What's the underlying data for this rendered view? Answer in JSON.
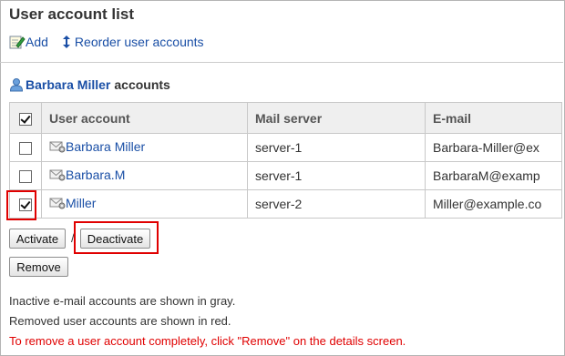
{
  "page": {
    "title": "User account list"
  },
  "toolbar": {
    "add_label": "Add",
    "reorder_label": "Reorder user accounts"
  },
  "section": {
    "user_name": "Barbara Miller",
    "suffix": "accounts"
  },
  "table": {
    "columns": [
      "User account",
      "Mail server",
      "E-mail"
    ],
    "rows": [
      {
        "checked": false,
        "account": "Barbara Miller",
        "server": "server-1",
        "email": "Barbara-Miller@ex"
      },
      {
        "checked": false,
        "account": "Barbara.M",
        "server": "server-1",
        "email": "BarbaraM@examp"
      },
      {
        "checked": true,
        "account": "Miller",
        "server": "server-2",
        "email": "Miller@example.co"
      }
    ]
  },
  "buttons": {
    "activate": "Activate",
    "separator": "/",
    "deactivate": "Deactivate",
    "remove": "Remove"
  },
  "notes": {
    "line1": "Inactive e-mail accounts are shown in gray.",
    "line2": "Removed user accounts are shown in red.",
    "line3": "To remove a user account completely, click \"Remove\" on the details screen."
  },
  "colors": {
    "link": "#1a4fa6",
    "highlight": "#e00000",
    "header_bg": "#efefef"
  },
  "icons": {
    "add": "pencil-note-icon",
    "reorder": "up-down-arrow-icon",
    "user": "person-icon",
    "mail_account": "mail-gear-icon"
  }
}
